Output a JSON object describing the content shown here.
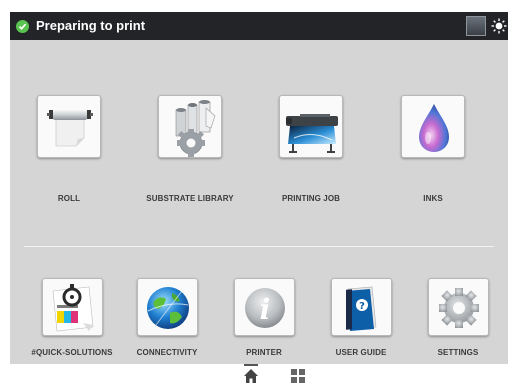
{
  "header": {
    "status_text": "Preparing to print",
    "status_color": "#59c44f"
  },
  "tiles_top": [
    {
      "label": "ROLL",
      "icon": "roll-icon"
    },
    {
      "label": "SUBSTRATE LIBRARY",
      "icon": "substrate-library-icon"
    },
    {
      "label": "PRINTING JOB",
      "icon": "printer-icon"
    },
    {
      "label": "INKS",
      "icon": "ink-drop-icon"
    }
  ],
  "tiles_bottom": [
    {
      "label": "#QUICK-SOLUTIONS",
      "icon": "quick-solutions-icon"
    },
    {
      "label": "CONNECTIVITY",
      "icon": "globe-icon"
    },
    {
      "label": "PRINTER",
      "icon": "info-icon"
    },
    {
      "label": "USER GUIDE",
      "icon": "user-guide-icon"
    },
    {
      "label": "SETTINGS",
      "icon": "gear-icon"
    }
  ],
  "nav": {
    "icons": [
      "home-icon",
      "grid-icon"
    ],
    "selected": "home"
  }
}
